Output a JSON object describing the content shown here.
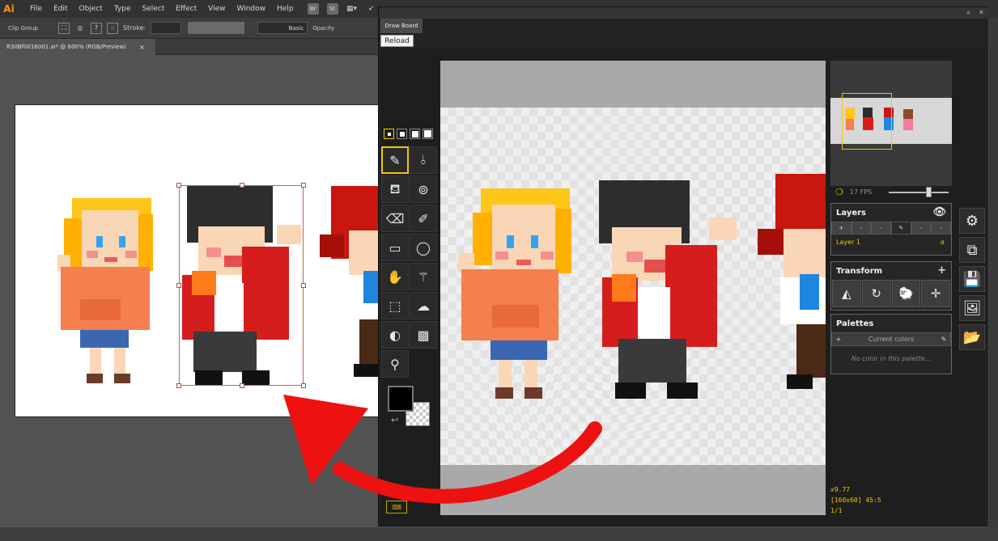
{
  "menubar": {
    "logo": "Ai",
    "items": [
      "File",
      "Edit",
      "Object",
      "Type",
      "Select",
      "Effect",
      "View",
      "Window",
      "Help"
    ],
    "badges": [
      "Br",
      "St"
    ]
  },
  "controlbar": {
    "selection_label": "Clip Group",
    "stroke_label": "Stroke:",
    "brush_label": "Basic",
    "opacity_label": "Opacity"
  },
  "document": {
    "tab_title": "R30Bf0016001.ai* @ 600% (RGB/Preview)",
    "close": "×"
  },
  "drawboard": {
    "panel_title": "Draw Board",
    "reload_label": "Reload",
    "tools": [
      "pencil",
      "line-mirror",
      "lasso-fill",
      "spray",
      "eraser",
      "stroke-pen",
      "rectangle",
      "ellipse",
      "hand",
      "magic-wand",
      "rect-select",
      "lasso-select",
      "lighten",
      "dither",
      "eyedropper"
    ],
    "fps": "17 FPS",
    "fps_fraction": 0.66,
    "layers": {
      "title": "Layers",
      "buttons": [
        "+",
        "-",
        "-",
        "✎",
        "-",
        "-"
      ],
      "items": [
        {
          "name": "Layer 1",
          "opacity_symbol": "α"
        }
      ]
    },
    "transform": {
      "title": "Transform",
      "add": "+"
    },
    "palettes": {
      "title": "Palettes",
      "selected": "Current colors",
      "empty_message": "No color in this palette..."
    },
    "status": {
      "zoom": "x9.77",
      "dimensions": "[160x60] 45:5",
      "frame": "1/1"
    }
  },
  "colors": {
    "accent": "#f2c500",
    "arrow": "#ee1111",
    "panel_bg": "#232323"
  }
}
